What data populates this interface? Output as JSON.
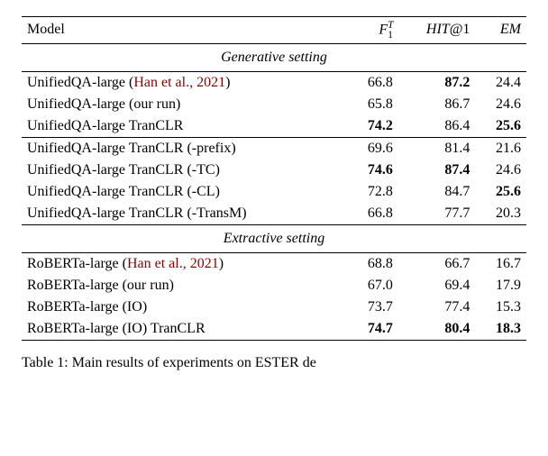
{
  "headers": {
    "model": "Model",
    "f1": "F",
    "f1_sub": "1",
    "f1_sup": "T",
    "hit": "HIT",
    "hit_at": "@1",
    "em": "EM"
  },
  "sections": {
    "generative": "Generative setting",
    "extractive": "Extractive setting"
  },
  "rows": {
    "g1": {
      "model_a": "UnifiedQA-large (",
      "cite": "Han et al., 2021",
      "model_b": ")",
      "f1": "66.8",
      "hit": "87.2",
      "em": "24.4"
    },
    "g2": {
      "model": "UnifiedQA-large (our run)",
      "f1": "65.8",
      "hit": "86.7",
      "em": "24.6"
    },
    "g3": {
      "model": "UnifiedQA-large TranCLR",
      "f1": "74.2",
      "hit": "86.4",
      "em": "25.6"
    },
    "a1": {
      "model": "UnifiedQA-large TranCLR (-prefix)",
      "f1": "69.6",
      "hit": "81.4",
      "em": "21.6"
    },
    "a2": {
      "model": "UnifiedQA-large TranCLR (-TC)",
      "f1": "74.6",
      "hit": "87.4",
      "em": "24.6"
    },
    "a3": {
      "model": "UnifiedQA-large TranCLR (-CL)",
      "f1": "72.8",
      "hit": "84.7",
      "em": "25.6"
    },
    "a4": {
      "model": "UnifiedQA-large TranCLR (-TransM)",
      "f1": "66.8",
      "hit": "77.7",
      "em": "20.3"
    },
    "e1": {
      "model_a": "RoBERTa-large (",
      "cite": "Han et al., 2021",
      "model_b": ")",
      "f1": "68.8",
      "hit": "66.7",
      "em": "16.7"
    },
    "e2": {
      "model": "RoBERTa-large (our run)",
      "f1": "67.0",
      "hit": "69.4",
      "em": "17.9"
    },
    "e3": {
      "model": "RoBERTa-large (IO)",
      "f1": "73.7",
      "hit": "77.4",
      "em": "15.3"
    },
    "e4": {
      "model": "RoBERTa-large (IO) TranCLR",
      "f1": "74.7",
      "hit": "80.4",
      "em": "18.3"
    }
  },
  "caption": "Table 1: Main results of experiments on ESTER de",
  "chart_data": {
    "type": "table",
    "title": "Main results of experiments on ESTER",
    "columns": [
      "Model",
      "F1^T",
      "HIT@1",
      "EM"
    ],
    "sections": [
      {
        "name": "Generative setting",
        "rows": [
          {
            "Model": "UnifiedQA-large (Han et al., 2021)",
            "F1^T": 66.8,
            "HIT@1": 87.2,
            "EM": 24.4
          },
          {
            "Model": "UnifiedQA-large (our run)",
            "F1^T": 65.8,
            "HIT@1": 86.7,
            "EM": 24.6
          },
          {
            "Model": "UnifiedQA-large TranCLR",
            "F1^T": 74.2,
            "HIT@1": 86.4,
            "EM": 25.6
          },
          {
            "Model": "UnifiedQA-large TranCLR (-prefix)",
            "F1^T": 69.6,
            "HIT@1": 81.4,
            "EM": 21.6
          },
          {
            "Model": "UnifiedQA-large TranCLR (-TC)",
            "F1^T": 74.6,
            "HIT@1": 87.4,
            "EM": 24.6
          },
          {
            "Model": "UnifiedQA-large TranCLR (-CL)",
            "F1^T": 72.8,
            "HIT@1": 84.7,
            "EM": 25.6
          },
          {
            "Model": "UnifiedQA-large TranCLR (-TransM)",
            "F1^T": 66.8,
            "HIT@1": 77.7,
            "EM": 20.3
          }
        ]
      },
      {
        "name": "Extractive setting",
        "rows": [
          {
            "Model": "RoBERTa-large (Han et al., 2021)",
            "F1^T": 68.8,
            "HIT@1": 66.7,
            "EM": 16.7
          },
          {
            "Model": "RoBERTa-large (our run)",
            "F1^T": 67.0,
            "HIT@1": 69.4,
            "EM": 17.9
          },
          {
            "Model": "RoBERTa-large (IO)",
            "F1^T": 73.7,
            "HIT@1": 77.4,
            "EM": 15.3
          },
          {
            "Model": "RoBERTa-large (IO) TranCLR",
            "F1^T": 74.7,
            "HIT@1": 80.4,
            "EM": 18.3
          }
        ]
      }
    ],
    "bold_cells": {
      "Generative setting": {
        "F1^T": 74.2,
        "HIT@1": 87.2,
        "EM": 25.6
      },
      "Generative ablation": {
        "F1^T": 74.6,
        "HIT@1": 87.4,
        "EM": 25.6
      },
      "Extractive setting": {
        "F1^T": 74.7,
        "HIT@1": 80.4,
        "EM": 18.3
      }
    }
  }
}
